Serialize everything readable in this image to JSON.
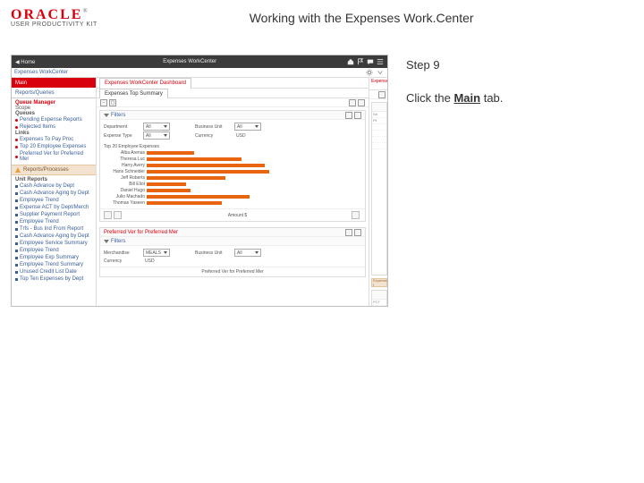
{
  "header": {
    "brand": "ORACLE",
    "tm": "®",
    "subbrand": "USER PRODUCTIVITY KIT",
    "title": "Working with the Expenses Work.Center"
  },
  "instruction": {
    "step_label": "Step 9",
    "line1_a": "Click the ",
    "main_word": "Main",
    "line1_b": " tab."
  },
  "shot": {
    "topbar": {
      "home": "◀ Home",
      "center": "Expenses WorkCenter"
    },
    "row2": {
      "label": "Expenses WorkCenter"
    },
    "sidebar": {
      "main_tab": "Main",
      "reports_tab": "Reports/Queries",
      "queue_header": "Queue Manager",
      "scope_label": "Scope",
      "group1": "Queues",
      "g1_items": [
        "Pending Expense Reports",
        "Rejected Items"
      ],
      "group2": "Links",
      "g2_items": [
        "Expenses To Pay Proc",
        "Top 20 Employee Expenses",
        "Preferred Ver for Preferred Mer"
      ],
      "divider": "Reports/Processes",
      "lower_header": "Unit Reports",
      "lower_items": [
        "Cash Advance by Dept",
        "Cash Advance Aging by Dept",
        "Employee Trend",
        "Expense ACT by Dept/Merch",
        "Supplier Payment Report",
        "Employee Trend",
        "Trfs - Bus Ind From Report",
        "Cash Advance Aging by Dept",
        "Employee Service Summary",
        "Employee Trend",
        "Employee Exp Summary",
        "Employee Trend Summary",
        "Unused Credit List Date",
        "Top Ten Expenses by Dept"
      ]
    },
    "center": {
      "dash_tab": "Expenses WorkCenter Dashboard",
      "sub_tab": "Expenses Top Summary",
      "panel1": {
        "title": "Filters",
        "row1_l": "Department",
        "row1_v": "All",
        "row1b_l": "Business Unit",
        "row1b_v": "All",
        "row2_l": "Expense Type",
        "row2_v": "All",
        "row2b_l": "Currency",
        "row2b_v": "USD"
      },
      "panel2": {
        "title": "Filters",
        "row1_l": "Merchandise",
        "row1_v": "MEALS",
        "row1b_l": "Business Unit",
        "row1b_v": "All",
        "row2_l": "Currency",
        "row2_v": "USD"
      },
      "panel2_outer_title": "Preferred Ver for Preferred Mer",
      "panel2_footer": "Preferred Ver for Preferred Mer",
      "chart_footer_center": "Amount  $"
    },
    "rstrip": {
      "head": "Expense",
      "lines": [
        "Sa",
        "Fil",
        " ",
        " ",
        " ",
        " "
      ],
      "badge": "Expenses t",
      "pct": "PCT"
    }
  },
  "chart_data": {
    "type": "bar",
    "title": "Top 20 Employee Expenses",
    "xlabel": "Amount $",
    "ylabel": "",
    "categories": [
      "Alba Arenas",
      "Theresa Luc",
      "Harry Avery",
      "Hans Schneider",
      "Jeff Roberts",
      "Bill Eliot",
      "Daniel Hugo",
      "Julio Machado",
      "Thomas Yaseen"
    ],
    "values": [
      60,
      120,
      150,
      155,
      100,
      50,
      55,
      130,
      95
    ],
    "xlim": [
      0,
      170
    ]
  }
}
